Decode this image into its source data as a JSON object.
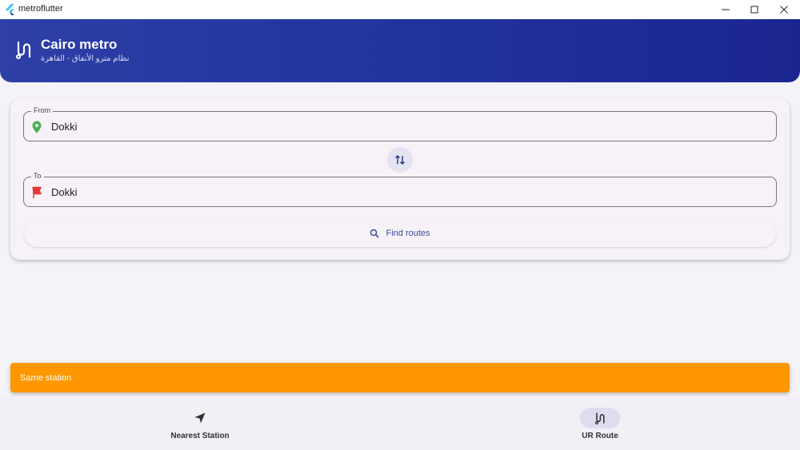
{
  "window": {
    "title": "metroflutter",
    "icon": "flutter-icon"
  },
  "header": {
    "icon": "route-icon",
    "title": "Cairo metro",
    "subtitle": "نظام مترو الأنفاق - القاهرة",
    "gradient_colors": [
      "#2e3fa6",
      "#1b2590"
    ]
  },
  "form": {
    "from": {
      "label": "From",
      "value": "Dokki",
      "icon": "location-pin-icon",
      "icon_color": "#4caf50"
    },
    "to": {
      "label": "To",
      "value": "Dokki",
      "icon": "flag-icon",
      "icon_color": "#e53935"
    },
    "swap_icon": "swap-vert-icon",
    "find_button": {
      "label": "Find routes",
      "icon": "search-icon"
    }
  },
  "snackbar": {
    "text": "Same station",
    "color": "#ff9800"
  },
  "bottom_nav": {
    "items": [
      {
        "label": "Nearest Station",
        "icon": "navigation-arrow-icon",
        "active": false
      },
      {
        "label": "UR Route",
        "icon": "route-icon",
        "active": true
      }
    ]
  }
}
